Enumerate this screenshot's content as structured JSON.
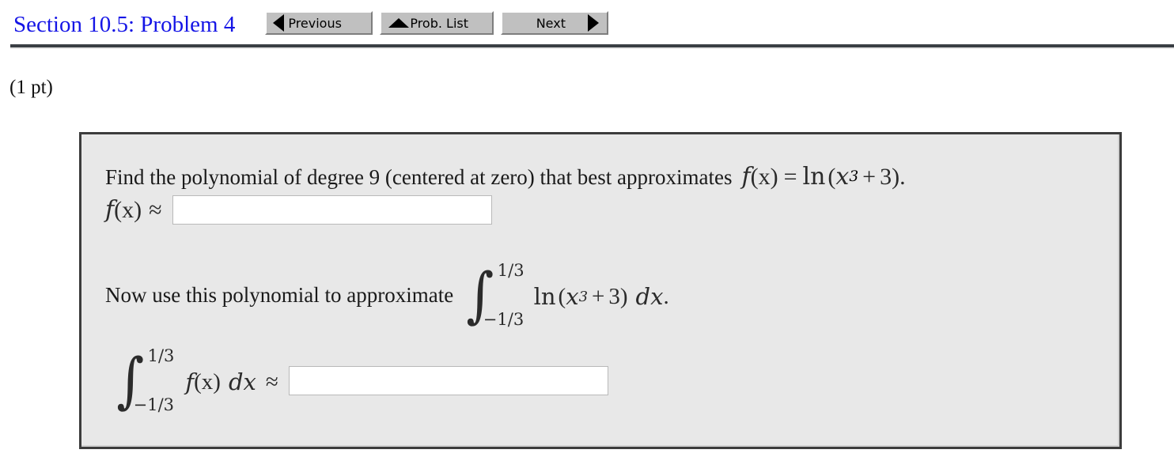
{
  "header": {
    "title": "Section 10.5: Problem 4",
    "title_color": "#1515e6",
    "nav": {
      "previous_label": "Previous",
      "prob_list_label": "Prob. List",
      "next_label": "Next",
      "prev_icon": "triangle-left-icon",
      "prob_list_icon": "triangle-up-icon",
      "next_icon": "triangle-right-icon"
    }
  },
  "points": "(1 pt)",
  "problem": {
    "prompt_text": "Find the polynomial of degree 9 (centered at zero) that best approximates",
    "function_def": {
      "lhs_f": "f",
      "lhs_arg": "(x)",
      "equals": "=",
      "ln": "ln",
      "open": "(",
      "base": "x",
      "exponent": "3",
      "plus": "+",
      "const": "3",
      "close": ")",
      "period": "."
    },
    "approx_line": {
      "f": "f",
      "arg": "(x)",
      "approx_symbol": "≈"
    },
    "answer_1": {
      "value": "",
      "placeholder": ""
    },
    "second_prompt": "Now use this polynomial to approximate",
    "integral_1": {
      "symbol": "∫",
      "upper_limit": "1/3",
      "lower_limit": "−1/3",
      "integrand_ln": "ln",
      "integrand_open": "(",
      "integrand_base": "x",
      "integrand_exp": "3",
      "integrand_plus": "+",
      "integrand_const": "3",
      "integrand_close": ")",
      "differential": "dx",
      "period": "."
    },
    "integral_2": {
      "symbol": "∫",
      "upper_limit": "1/3",
      "lower_limit": "−1/3",
      "integrand_f": "f",
      "integrand_arg": "(x)",
      "differential": "dx",
      "approx_symbol": "≈"
    },
    "answer_2": {
      "value": "",
      "placeholder": ""
    }
  },
  "colors": {
    "box_background": "#e8e8e8",
    "box_border": "#3c3c3c",
    "rule": "#3a3f44",
    "button_face": "#c0c0c0",
    "input_background": "#ffffff"
  }
}
